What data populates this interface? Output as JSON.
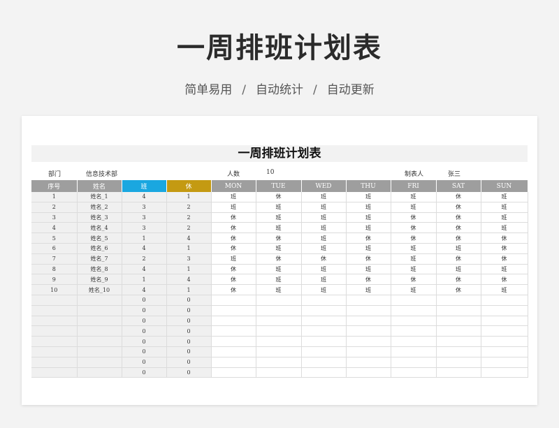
{
  "page": {
    "title": "一周排班计划表",
    "subtitle": [
      "简单易用",
      "自动统计",
      "自动更新"
    ],
    "separator": "/"
  },
  "sheet": {
    "title": "一周排班计划表",
    "info": {
      "dept_label": "部门",
      "dept_value": "信息技术部",
      "count_label": "人数",
      "count_value": "10",
      "maker_label": "制表人",
      "maker_value": "张三"
    },
    "headers": [
      "序号",
      "姓名",
      "班",
      "休",
      "MON",
      "TUE",
      "WED",
      "THU",
      "FRI",
      "SAT",
      "SUN"
    ],
    "rows": [
      {
        "no": "1",
        "name": "姓名_1",
        "work": "4",
        "rest": "1",
        "days": [
          "班",
          "休",
          "班",
          "班",
          "班",
          "休",
          "班"
        ]
      },
      {
        "no": "2",
        "name": "姓名_2",
        "work": "3",
        "rest": "2",
        "days": [
          "班",
          "班",
          "班",
          "班",
          "班",
          "休",
          "班"
        ]
      },
      {
        "no": "3",
        "name": "姓名_3",
        "work": "3",
        "rest": "2",
        "days": [
          "休",
          "班",
          "班",
          "班",
          "休",
          "休",
          "班"
        ]
      },
      {
        "no": "4",
        "name": "姓名_4",
        "work": "3",
        "rest": "2",
        "days": [
          "休",
          "班",
          "班",
          "班",
          "休",
          "休",
          "班"
        ]
      },
      {
        "no": "5",
        "name": "姓名_5",
        "work": "1",
        "rest": "4",
        "days": [
          "休",
          "休",
          "班",
          "休",
          "休",
          "休",
          "休"
        ]
      },
      {
        "no": "6",
        "name": "姓名_6",
        "work": "4",
        "rest": "1",
        "days": [
          "休",
          "班",
          "班",
          "班",
          "班",
          "班",
          "休"
        ]
      },
      {
        "no": "7",
        "name": "姓名_7",
        "work": "2",
        "rest": "3",
        "days": [
          "班",
          "休",
          "休",
          "休",
          "班",
          "休",
          "休"
        ]
      },
      {
        "no": "8",
        "name": "姓名_8",
        "work": "4",
        "rest": "1",
        "days": [
          "休",
          "班",
          "班",
          "班",
          "班",
          "班",
          "班"
        ]
      },
      {
        "no": "9",
        "name": "姓名_9",
        "work": "1",
        "rest": "4",
        "days": [
          "休",
          "班",
          "班",
          "休",
          "休",
          "休",
          "休"
        ]
      },
      {
        "no": "10",
        "name": "姓名_10",
        "work": "4",
        "rest": "1",
        "days": [
          "休",
          "班",
          "班",
          "班",
          "班",
          "休",
          "班"
        ]
      },
      {
        "no": "",
        "name": "",
        "work": "0",
        "rest": "0",
        "days": [
          "",
          "",
          "",
          "",
          "",
          "",
          ""
        ]
      },
      {
        "no": "",
        "name": "",
        "work": "0",
        "rest": "0",
        "days": [
          "",
          "",
          "",
          "",
          "",
          "",
          ""
        ]
      },
      {
        "no": "",
        "name": "",
        "work": "0",
        "rest": "0",
        "days": [
          "",
          "",
          "",
          "",
          "",
          "",
          ""
        ]
      },
      {
        "no": "",
        "name": "",
        "work": "0",
        "rest": "0",
        "days": [
          "",
          "",
          "",
          "",
          "",
          "",
          ""
        ]
      },
      {
        "no": "",
        "name": "",
        "work": "0",
        "rest": "0",
        "days": [
          "",
          "",
          "",
          "",
          "",
          "",
          ""
        ]
      },
      {
        "no": "",
        "name": "",
        "work": "0",
        "rest": "0",
        "days": [
          "",
          "",
          "",
          "",
          "",
          "",
          ""
        ]
      },
      {
        "no": "",
        "name": "",
        "work": "0",
        "rest": "0",
        "days": [
          "",
          "",
          "",
          "",
          "",
          "",
          ""
        ]
      },
      {
        "no": "",
        "name": "",
        "work": "0",
        "rest": "0",
        "days": [
          "",
          "",
          "",
          "",
          "",
          "",
          ""
        ]
      }
    ]
  },
  "colors": {
    "work": "#1aa7e0",
    "rest": "#c49a12",
    "header": "#9e9e9e"
  }
}
